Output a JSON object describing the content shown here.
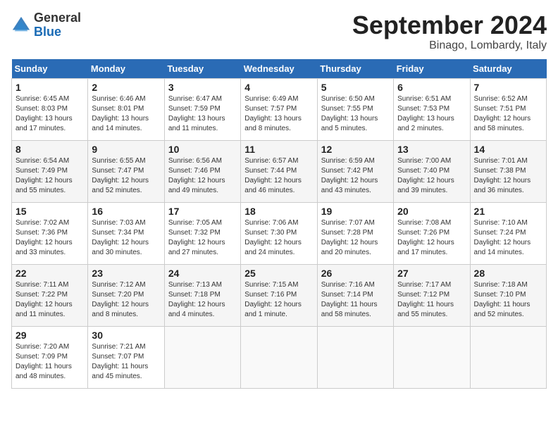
{
  "header": {
    "logo_general": "General",
    "logo_blue": "Blue",
    "month_title": "September 2024",
    "location": "Binago, Lombardy, Italy"
  },
  "days_of_week": [
    "Sunday",
    "Monday",
    "Tuesday",
    "Wednesday",
    "Thursday",
    "Friday",
    "Saturday"
  ],
  "weeks": [
    [
      {
        "day": 1,
        "sunrise": "6:45 AM",
        "sunset": "8:03 PM",
        "daylight": "13 hours and 17 minutes."
      },
      {
        "day": 2,
        "sunrise": "6:46 AM",
        "sunset": "8:01 PM",
        "daylight": "13 hours and 14 minutes."
      },
      {
        "day": 3,
        "sunrise": "6:47 AM",
        "sunset": "7:59 PM",
        "daylight": "13 hours and 11 minutes."
      },
      {
        "day": 4,
        "sunrise": "6:49 AM",
        "sunset": "7:57 PM",
        "daylight": "13 hours and 8 minutes."
      },
      {
        "day": 5,
        "sunrise": "6:50 AM",
        "sunset": "7:55 PM",
        "daylight": "13 hours and 5 minutes."
      },
      {
        "day": 6,
        "sunrise": "6:51 AM",
        "sunset": "7:53 PM",
        "daylight": "13 hours and 2 minutes."
      },
      {
        "day": 7,
        "sunrise": "6:52 AM",
        "sunset": "7:51 PM",
        "daylight": "12 hours and 58 minutes."
      }
    ],
    [
      {
        "day": 8,
        "sunrise": "6:54 AM",
        "sunset": "7:49 PM",
        "daylight": "12 hours and 55 minutes."
      },
      {
        "day": 9,
        "sunrise": "6:55 AM",
        "sunset": "7:47 PM",
        "daylight": "12 hours and 52 minutes."
      },
      {
        "day": 10,
        "sunrise": "6:56 AM",
        "sunset": "7:46 PM",
        "daylight": "12 hours and 49 minutes."
      },
      {
        "day": 11,
        "sunrise": "6:57 AM",
        "sunset": "7:44 PM",
        "daylight": "12 hours and 46 minutes."
      },
      {
        "day": 12,
        "sunrise": "6:59 AM",
        "sunset": "7:42 PM",
        "daylight": "12 hours and 43 minutes."
      },
      {
        "day": 13,
        "sunrise": "7:00 AM",
        "sunset": "7:40 PM",
        "daylight": "12 hours and 39 minutes."
      },
      {
        "day": 14,
        "sunrise": "7:01 AM",
        "sunset": "7:38 PM",
        "daylight": "12 hours and 36 minutes."
      }
    ],
    [
      {
        "day": 15,
        "sunrise": "7:02 AM",
        "sunset": "7:36 PM",
        "daylight": "12 hours and 33 minutes."
      },
      {
        "day": 16,
        "sunrise": "7:03 AM",
        "sunset": "7:34 PM",
        "daylight": "12 hours and 30 minutes."
      },
      {
        "day": 17,
        "sunrise": "7:05 AM",
        "sunset": "7:32 PM",
        "daylight": "12 hours and 27 minutes."
      },
      {
        "day": 18,
        "sunrise": "7:06 AM",
        "sunset": "7:30 PM",
        "daylight": "12 hours and 24 minutes."
      },
      {
        "day": 19,
        "sunrise": "7:07 AM",
        "sunset": "7:28 PM",
        "daylight": "12 hours and 20 minutes."
      },
      {
        "day": 20,
        "sunrise": "7:08 AM",
        "sunset": "7:26 PM",
        "daylight": "12 hours and 17 minutes."
      },
      {
        "day": 21,
        "sunrise": "7:10 AM",
        "sunset": "7:24 PM",
        "daylight": "12 hours and 14 minutes."
      }
    ],
    [
      {
        "day": 22,
        "sunrise": "7:11 AM",
        "sunset": "7:22 PM",
        "daylight": "12 hours and 11 minutes."
      },
      {
        "day": 23,
        "sunrise": "7:12 AM",
        "sunset": "7:20 PM",
        "daylight": "12 hours and 8 minutes."
      },
      {
        "day": 24,
        "sunrise": "7:13 AM",
        "sunset": "7:18 PM",
        "daylight": "12 hours and 4 minutes."
      },
      {
        "day": 25,
        "sunrise": "7:15 AM",
        "sunset": "7:16 PM",
        "daylight": "12 hours and 1 minute."
      },
      {
        "day": 26,
        "sunrise": "7:16 AM",
        "sunset": "7:14 PM",
        "daylight": "11 hours and 58 minutes."
      },
      {
        "day": 27,
        "sunrise": "7:17 AM",
        "sunset": "7:12 PM",
        "daylight": "11 hours and 55 minutes."
      },
      {
        "day": 28,
        "sunrise": "7:18 AM",
        "sunset": "7:10 PM",
        "daylight": "11 hours and 52 minutes."
      }
    ],
    [
      {
        "day": 29,
        "sunrise": "7:20 AM",
        "sunset": "7:09 PM",
        "daylight": "11 hours and 48 minutes."
      },
      {
        "day": 30,
        "sunrise": "7:21 AM",
        "sunset": "7:07 PM",
        "daylight": "11 hours and 45 minutes."
      },
      null,
      null,
      null,
      null,
      null
    ]
  ]
}
